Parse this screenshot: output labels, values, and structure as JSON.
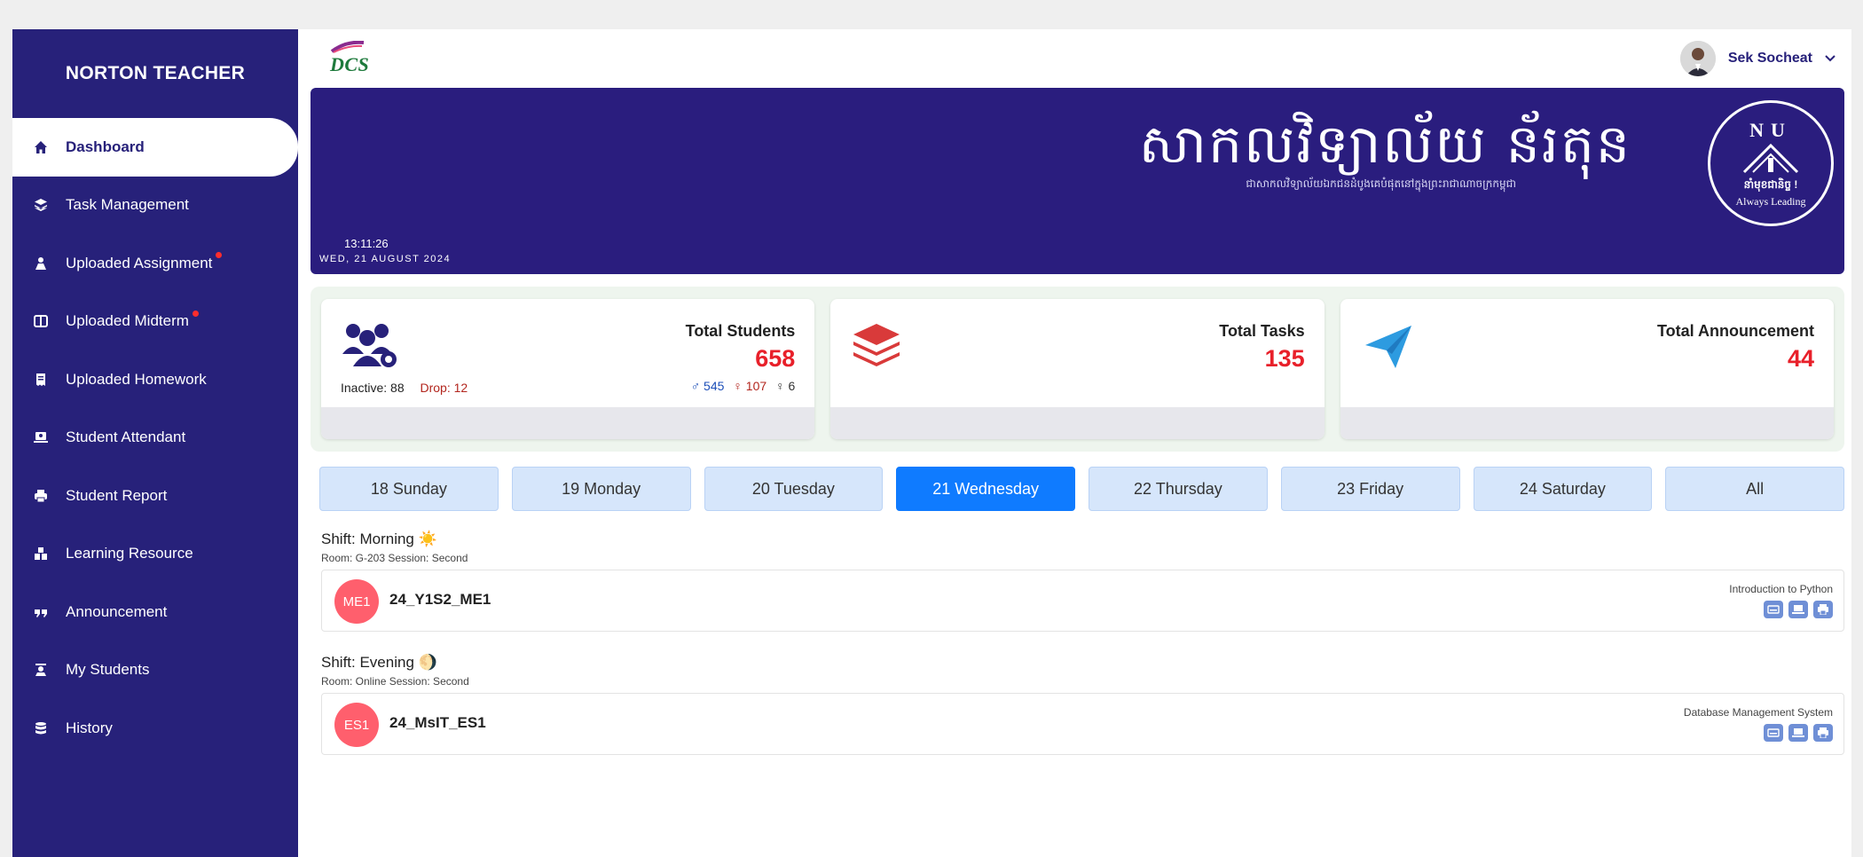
{
  "sidebar": {
    "brand": "NORTON TEACHER",
    "items": [
      {
        "label": "Dashboard",
        "icon": "home-icon",
        "active": true
      },
      {
        "label": "Task Management",
        "icon": "layers-icon"
      },
      {
        "label": "Uploaded Assignment",
        "icon": "users-icon",
        "dot": true
      },
      {
        "label": "Uploaded Midterm",
        "icon": "columns-icon",
        "dot": true
      },
      {
        "label": "Uploaded Homework",
        "icon": "receipt-icon"
      },
      {
        "label": "Student Attendant",
        "icon": "laptop-icon"
      },
      {
        "label": "Student Report",
        "icon": "printer-icon"
      },
      {
        "label": "Learning Resource",
        "icon": "boxes-icon"
      },
      {
        "label": "Announcement",
        "icon": "quote-icon"
      },
      {
        "label": "My Students",
        "icon": "teacher-icon"
      },
      {
        "label": "History",
        "icon": "database-icon"
      }
    ]
  },
  "topbar": {
    "logo": "DCS",
    "user_name": "Sek Socheat"
  },
  "banner": {
    "title": "សាកលវិទ្យាល័យ ន័រតុន",
    "subtitle": "ជាសាកលវិទ្យាល័យឯកជនដំបូងគេបំផុតនៅក្នុងព្រះរាជាណាចក្រកម្ពុជា",
    "time": "13:11:26",
    "date": "WED, 21 AUGUST 2024",
    "seal_letters": "NU",
    "seal_khmer": "នាំមុខជានិច្ច !",
    "seal_english": "Always Leading"
  },
  "stats": {
    "students": {
      "label": "Total Students",
      "value": "658",
      "inactive": "Inactive: 88",
      "drop": "Drop: 12",
      "male": "♂ 545",
      "female": "♀ 107",
      "other": "♀ 6"
    },
    "tasks": {
      "label": "Total Tasks",
      "value": "135"
    },
    "announcements": {
      "label": "Total Announcement",
      "value": "44"
    }
  },
  "days": [
    "18 Sunday",
    "19 Monday",
    "20 Tuesday",
    "21 Wednesday",
    "22 Thursday",
    "23 Friday",
    "24 Saturday",
    "All"
  ],
  "active_day_index": 3,
  "shifts": [
    {
      "title": "Shift: Morning ☀️",
      "meta": "Room: G-203 Session: Second",
      "badge": "ME1",
      "class_name": "24_Y1S2_ME1",
      "course": "Introduction to Python"
    },
    {
      "title": "Shift: Evening 🌖",
      "meta": "Room: Online Session: Second",
      "badge": "ES1",
      "class_name": "24_MsIT_ES1",
      "course": "Database Management System"
    }
  ],
  "colors": {
    "sidebar_bg": "#27217a",
    "banner_bg": "#2a1d7e",
    "accent": "#e8202a",
    "day_active": "#0f7bff",
    "badge": "#ff5f6d"
  }
}
